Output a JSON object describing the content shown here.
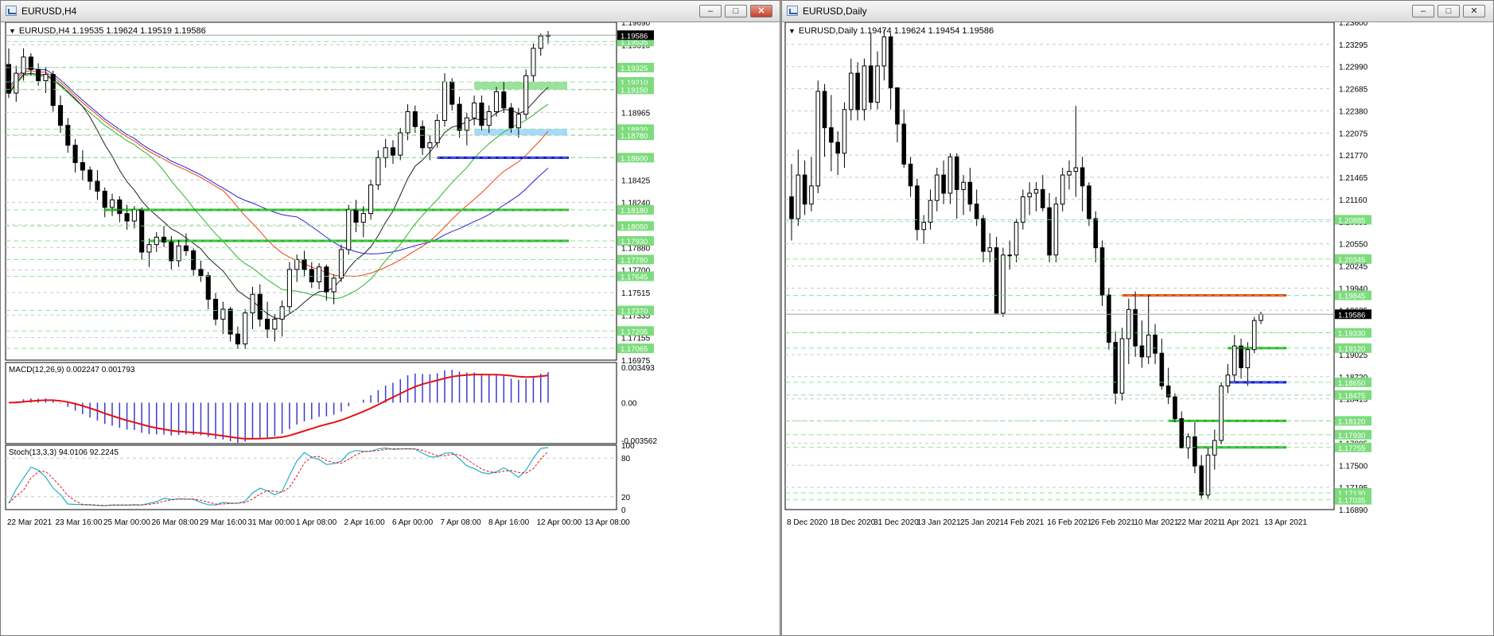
{
  "colors": {
    "grid": "#c8c8c8",
    "bull_fill": "#ffffff",
    "bear_fill": "#000000",
    "candle_line": "#000000",
    "sma_blue": "#2323d8",
    "sma_red": "#f04010",
    "sma_green": "#28b428",
    "sma_black": "#202020",
    "level_green": "#24b824",
    "level_blue": "#1010e0",
    "level_red": "#f04010",
    "zone_green": "#8fe08f",
    "zone_blue": "#9fd6ff",
    "price_tag_green": "#7ddc7d",
    "macd_hist": "#3a3ad0",
    "macd_signal": "#e81010",
    "stoch_main": "#20b0c8",
    "stoch_signal": "#e81010"
  },
  "windows": {
    "h4": {
      "title": "EURUSD,H4",
      "symbol_info": "EURUSD,H4  1.19535 1.19624 1.19519 1.19586",
      "buttons": {
        "minimize": "–",
        "maximize": "□",
        "close": "✕"
      }
    },
    "daily": {
      "title": "EURUSD,Daily",
      "symbol_info": "EURUSD,Daily  1.19474 1.19624 1.19454 1.19586",
      "buttons": {
        "minimize": "–",
        "maximize": "□",
        "close": "✕"
      }
    }
  },
  "chart_data": [
    {
      "type": "candlestick",
      "symbol": "EURUSD",
      "timeframe": "H4",
      "ylim": [
        1.1697,
        1.1969
      ],
      "y_ticks": [
        "1.19690",
        "1.19510",
        "1.19330",
        "1.19150",
        "1.18965",
        "1.18785",
        "1.18605",
        "1.18425",
        "1.18240",
        "1.18060",
        "1.17880",
        "1.17700",
        "1.17515",
        "1.17335",
        "1.17155",
        "1.16975"
      ],
      "x_ticks": [
        "22 Mar 2021",
        "23 Mar 16:00",
        "25 Mar 00:00",
        "26 Mar 08:00",
        "29 Mar 16:00",
        "31 Mar 00:00",
        "1 Apr 08:00",
        "2 Apr 16:00",
        "6 Apr 00:00",
        "7 Apr 08:00",
        "8 Apr 16:00",
        "12 Apr 00:00",
        "13 Apr 08:00"
      ],
      "current_price": "1.19586",
      "price_tags": [
        "1.19535",
        "1.19325",
        "1.19210",
        "1.19150",
        "1.18830",
        "1.18780",
        "1.18600",
        "1.18180",
        "1.18050",
        "1.17930",
        "1.17780",
        "1.17645",
        "1.17370",
        "1.17205",
        "1.17065"
      ],
      "levels": [
        {
          "price": 1.186,
          "color": "blue",
          "kind": "support"
        },
        {
          "price": 1.1818,
          "color": "green",
          "kind": "support"
        },
        {
          "price": 1.1793,
          "color": "green",
          "kind": "support"
        }
      ],
      "zones": [
        {
          "from": 1.1915,
          "to": 1.1921,
          "color": "green"
        },
        {
          "from": 1.1878,
          "to": 1.1883,
          "color": "blue"
        }
      ],
      "candles": [
        [
          1.1935,
          1.1948,
          1.1908,
          1.1912
        ],
        [
          1.1912,
          1.1934,
          1.1905,
          1.1928
        ],
        [
          1.1928,
          1.1948,
          1.1922,
          1.1941
        ],
        [
          1.1941,
          1.1944,
          1.1926,
          1.1931
        ],
        [
          1.1931,
          1.1936,
          1.1918,
          1.1922
        ],
        [
          1.1922,
          1.1933,
          1.1912,
          1.1927
        ],
        [
          1.1927,
          1.193,
          1.1897,
          1.1902
        ],
        [
          1.1902,
          1.191,
          1.188,
          1.1886
        ],
        [
          1.1886,
          1.1892,
          1.1864,
          1.187
        ],
        [
          1.187,
          1.1875,
          1.1848,
          1.1856
        ],
        [
          1.1856,
          1.1866,
          1.1842,
          1.185
        ],
        [
          1.185,
          1.1853,
          1.1834,
          1.1841
        ],
        [
          1.1841,
          1.185,
          1.1826,
          1.1833
        ],
        [
          1.1833,
          1.1836,
          1.1812,
          1.182
        ],
        [
          1.182,
          1.1831,
          1.1813,
          1.1826
        ],
        [
          1.1826,
          1.1829,
          1.1808,
          1.1815
        ],
        [
          1.1815,
          1.1822,
          1.1802,
          1.1809
        ],
        [
          1.1809,
          1.1821,
          1.1803,
          1.1818
        ],
        [
          1.1818,
          1.182,
          1.1778,
          1.1784
        ],
        [
          1.1784,
          1.1795,
          1.1772,
          1.179
        ],
        [
          1.179,
          1.18,
          1.1784,
          1.1796
        ],
        [
          1.1796,
          1.1805,
          1.1788,
          1.1792
        ],
        [
          1.1792,
          1.1797,
          1.177,
          1.1777
        ],
        [
          1.1777,
          1.1794,
          1.1772,
          1.1789
        ],
        [
          1.1789,
          1.1799,
          1.1781,
          1.1785
        ],
        [
          1.1785,
          1.1787,
          1.1765,
          1.177
        ],
        [
          1.177,
          1.1777,
          1.176,
          1.1765
        ],
        [
          1.1765,
          1.1768,
          1.1738,
          1.1746
        ],
        [
          1.1746,
          1.1751,
          1.1725,
          1.173
        ],
        [
          1.173,
          1.1744,
          1.1718,
          1.1738
        ],
        [
          1.1738,
          1.174,
          1.1712,
          1.1718
        ],
        [
          1.1718,
          1.1724,
          1.1706,
          1.171
        ],
        [
          1.171,
          1.1738,
          1.1706,
          1.1735
        ],
        [
          1.1735,
          1.1756,
          1.1722,
          1.175
        ],
        [
          1.175,
          1.1758,
          1.1724,
          1.173
        ],
        [
          1.173,
          1.1744,
          1.1715,
          1.1722
        ],
        [
          1.1722,
          1.1734,
          1.1712,
          1.173
        ],
        [
          1.173,
          1.1745,
          1.1716,
          1.174
        ],
        [
          1.174,
          1.1776,
          1.1735,
          1.177
        ],
        [
          1.177,
          1.1782,
          1.176,
          1.1778
        ],
        [
          1.1778,
          1.1785,
          1.1764,
          1.177
        ],
        [
          1.177,
          1.1776,
          1.1755,
          1.176
        ],
        [
          1.176,
          1.1775,
          1.1754,
          1.1772
        ],
        [
          1.1772,
          1.1774,
          1.1745,
          1.1752
        ],
        [
          1.1752,
          1.1766,
          1.1742,
          1.1763
        ],
        [
          1.1763,
          1.179,
          1.176,
          1.1786
        ],
        [
          1.1786,
          1.1822,
          1.1782,
          1.1818
        ],
        [
          1.1818,
          1.1826,
          1.18,
          1.1808
        ],
        [
          1.1808,
          1.1821,
          1.1796,
          1.1815
        ],
        [
          1.1815,
          1.1842,
          1.181,
          1.1838
        ],
        [
          1.1838,
          1.1866,
          1.1834,
          1.186
        ],
        [
          1.186,
          1.1875,
          1.1852,
          1.1868
        ],
        [
          1.1868,
          1.1874,
          1.1855,
          1.1862
        ],
        [
          1.1862,
          1.1884,
          1.1858,
          1.188
        ],
        [
          1.188,
          1.1903,
          1.1874,
          1.1897
        ],
        [
          1.1897,
          1.1902,
          1.188,
          1.1885
        ],
        [
          1.1885,
          1.189,
          1.1862,
          1.1868
        ],
        [
          1.1868,
          1.1878,
          1.1858,
          1.1872
        ],
        [
          1.1872,
          1.1895,
          1.1868,
          1.189
        ],
        [
          1.189,
          1.1928,
          1.1885,
          1.1921
        ],
        [
          1.1921,
          1.1924,
          1.1898,
          1.1903
        ],
        [
          1.1903,
          1.1909,
          1.1876,
          1.1882
        ],
        [
          1.1882,
          1.1896,
          1.187,
          1.1892
        ],
        [
          1.1892,
          1.191,
          1.1886,
          1.1904
        ],
        [
          1.1904,
          1.191,
          1.1882,
          1.1886
        ],
        [
          1.1886,
          1.1902,
          1.188,
          1.1897
        ],
        [
          1.1897,
          1.1917,
          1.1893,
          1.1913
        ],
        [
          1.1913,
          1.1921,
          1.1896,
          1.19
        ],
        [
          1.19,
          1.1904,
          1.188,
          1.1884
        ],
        [
          1.1884,
          1.19,
          1.1876,
          1.1895
        ],
        [
          1.1895,
          1.1931,
          1.1891,
          1.1926
        ],
        [
          1.1926,
          1.1952,
          1.1921,
          1.1948
        ],
        [
          1.1948,
          1.196,
          1.1942,
          1.1958
        ],
        [
          1.1958,
          1.1962,
          1.1952,
          1.19586
        ]
      ],
      "indicators": {
        "macd": {
          "label": "MACD(12,26,9) 0.002247 0.001793",
          "y_ticks": [
            "0.003493",
            "0.00",
            "-0.003562"
          ],
          "ylim": [
            -0.003562,
            0.003493
          ]
        },
        "stochastic": {
          "label": "Stoch(13,3,3) 94.0106 92.2245",
          "y_ticks": [
            "100",
            "80",
            "20",
            "0"
          ],
          "ylim": [
            0,
            100
          ]
        }
      }
    },
    {
      "type": "candlestick",
      "symbol": "EURUSD",
      "timeframe": "Daily",
      "ylim": [
        1.169,
        1.236
      ],
      "y_ticks": [
        "1.23600",
        "1.23295",
        "1.22990",
        "1.22685",
        "1.22380",
        "1.22075",
        "1.21770",
        "1.21465",
        "1.21160",
        "1.20855",
        "1.20550",
        "1.20245",
        "1.19940",
        "1.19635",
        "1.19330",
        "1.19025",
        "1.18720",
        "1.18415",
        "1.18110",
        "1.17805",
        "1.17500",
        "1.17195",
        "1.16890"
      ],
      "x_ticks": [
        "8 Dec 2020",
        "18 Dec 2020",
        "31 Dec 2020",
        "13 Jan 2021",
        "25 Jan 2021",
        "4 Feb 2021",
        "16 Feb 2021",
        "26 Feb 2021",
        "10 Mar 2021",
        "22 Mar 2021",
        "1 Apr 2021",
        "13 Apr 2021"
      ],
      "current_price": "1.19586",
      "price_tags": [
        "1.20885",
        "1.20345",
        "1.19845",
        "1.19330",
        "1.19120",
        "1.18650",
        "1.18475",
        "1.18120",
        "1.17930",
        "1.17755",
        "1.17130",
        "1.17035"
      ],
      "levels": [
        {
          "price": 1.19845,
          "color": "red",
          "kind": "resistance"
        },
        {
          "price": 1.1912,
          "color": "green",
          "kind": "support"
        },
        {
          "price": 1.1865,
          "color": "blue",
          "kind": "support"
        },
        {
          "price": 1.1812,
          "color": "green",
          "kind": "support"
        },
        {
          "price": 1.17755,
          "color": "green",
          "kind": "support"
        }
      ],
      "candles": [
        [
          1.212,
          1.2165,
          1.206,
          1.209
        ],
        [
          1.209,
          1.2185,
          1.208,
          1.215
        ],
        [
          1.215,
          1.217,
          1.2095,
          1.211
        ],
        [
          1.211,
          1.2175,
          1.21,
          1.2135
        ],
        [
          1.2135,
          1.228,
          1.2125,
          1.2265
        ],
        [
          1.2265,
          1.2275,
          1.2175,
          1.2215
        ],
        [
          1.2215,
          1.226,
          1.2155,
          1.2195
        ],
        [
          1.2195,
          1.221,
          1.215,
          1.218
        ],
        [
          1.218,
          1.225,
          1.216,
          1.224
        ],
        [
          1.224,
          1.231,
          1.2225,
          1.229
        ],
        [
          1.229,
          1.2305,
          1.2225,
          1.224
        ],
        [
          1.224,
          1.231,
          1.2225,
          1.23
        ],
        [
          1.23,
          1.2345,
          1.224,
          1.225
        ],
        [
          1.225,
          1.232,
          1.224,
          1.23
        ],
        [
          1.23,
          1.235,
          1.228,
          1.234
        ],
        [
          1.234,
          1.2345,
          1.224,
          1.227
        ],
        [
          1.227,
          1.227,
          1.2195,
          1.222
        ],
        [
          1.222,
          1.224,
          1.216,
          1.2165
        ],
        [
          1.2165,
          1.2175,
          1.212,
          1.2135
        ],
        [
          1.2135,
          1.2145,
          1.206,
          1.2075
        ],
        [
          1.2075,
          1.2095,
          1.2055,
          1.2085
        ],
        [
          1.2085,
          1.213,
          1.2075,
          1.2115
        ],
        [
          1.2115,
          1.216,
          1.21,
          1.215
        ],
        [
          1.215,
          1.217,
          1.211,
          1.2125
        ],
        [
          1.2125,
          1.218,
          1.211,
          1.2175
        ],
        [
          1.2175,
          1.218,
          1.209,
          1.213
        ],
        [
          1.213,
          1.215,
          1.2095,
          1.214
        ],
        [
          1.214,
          1.216,
          1.21,
          1.211
        ],
        [
          1.211,
          1.213,
          1.208,
          1.209
        ],
        [
          1.209,
          1.2095,
          1.203,
          1.2045
        ],
        [
          1.2045,
          1.207,
          1.203,
          1.205
        ],
        [
          1.205,
          1.2065,
          1.196,
          1.196
        ],
        [
          1.196,
          1.205,
          1.1955,
          1.204
        ],
        [
          1.204,
          1.206,
          1.202,
          1.204
        ],
        [
          1.204,
          1.209,
          1.203,
          1.2085
        ],
        [
          1.2085,
          1.213,
          1.2075,
          1.212
        ],
        [
          1.212,
          1.214,
          1.2095,
          1.2125
        ],
        [
          1.2125,
          1.214,
          1.21,
          1.213
        ],
        [
          1.213,
          1.215,
          1.21,
          1.2105
        ],
        [
          1.2105,
          1.2125,
          1.203,
          1.204
        ],
        [
          1.204,
          1.212,
          1.203,
          1.211
        ],
        [
          1.211,
          1.216,
          1.21,
          1.215
        ],
        [
          1.215,
          1.217,
          1.213,
          1.2155
        ],
        [
          1.2155,
          1.2245,
          1.212,
          1.216
        ],
        [
          1.216,
          1.2175,
          1.21,
          1.2135
        ],
        [
          1.2135,
          1.214,
          1.208,
          1.209
        ],
        [
          1.209,
          1.21,
          1.203,
          1.205
        ],
        [
          1.205,
          1.206,
          1.197,
          1.1985
        ],
        [
          1.1985,
          1.1995,
          1.191,
          1.192
        ],
        [
          1.192,
          1.1935,
          1.1835,
          1.185
        ],
        [
          1.185,
          1.194,
          1.184,
          1.1925
        ],
        [
          1.1925,
          1.198,
          1.189,
          1.1965
        ],
        [
          1.1965,
          1.199,
          1.19,
          1.1915
        ],
        [
          1.1915,
          1.195,
          1.1885,
          1.19
        ],
        [
          1.19,
          1.1985,
          1.189,
          1.193
        ],
        [
          1.193,
          1.1945,
          1.189,
          1.1905
        ],
        [
          1.1905,
          1.1925,
          1.1855,
          1.186
        ],
        [
          1.186,
          1.1885,
          1.1835,
          1.1845
        ],
        [
          1.1845,
          1.185,
          1.181,
          1.1815
        ],
        [
          1.1815,
          1.1825,
          1.1775,
          1.1775
        ],
        [
          1.1775,
          1.1795,
          1.176,
          1.179
        ],
        [
          1.179,
          1.181,
          1.174,
          1.175
        ],
        [
          1.175,
          1.1765,
          1.1705,
          1.171
        ],
        [
          1.171,
          1.1775,
          1.1705,
          1.1765
        ],
        [
          1.1765,
          1.18,
          1.1745,
          1.1785
        ],
        [
          1.1785,
          1.1865,
          1.178,
          1.186
        ],
        [
          1.186,
          1.189,
          1.185,
          1.1875
        ],
        [
          1.1875,
          1.193,
          1.1865,
          1.1915
        ],
        [
          1.1915,
          1.1925,
          1.187,
          1.1885
        ],
        [
          1.1885,
          1.192,
          1.186,
          1.191
        ],
        [
          1.191,
          1.1955,
          1.1905,
          1.195
        ],
        [
          1.195,
          1.1962,
          1.1945,
          1.19586
        ]
      ]
    }
  ]
}
